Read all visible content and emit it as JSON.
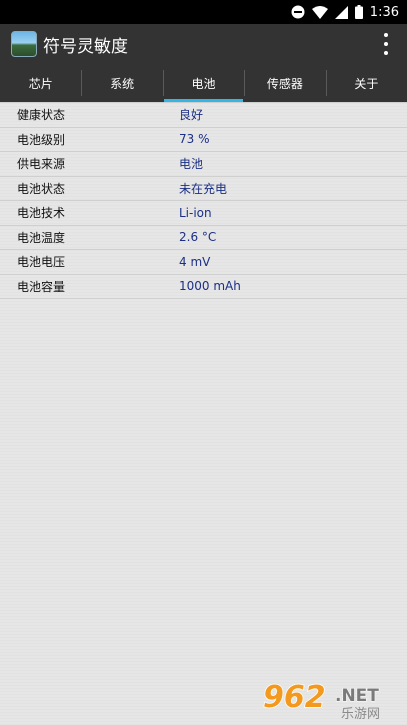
{
  "status_bar": {
    "time": "1:36",
    "icons": [
      "do-not-disturb-icon",
      "wifi-icon",
      "signal-icon",
      "battery-icon"
    ]
  },
  "app_bar": {
    "title": "符号灵敏度",
    "icon": "app-icon",
    "menu_icon": "overflow-menu-icon"
  },
  "tabs": [
    {
      "label": "芯片",
      "active": false
    },
    {
      "label": "系统",
      "active": false
    },
    {
      "label": "电池",
      "active": true
    },
    {
      "label": "传感器",
      "active": false
    },
    {
      "label": "关于",
      "active": false
    }
  ],
  "battery_info": [
    {
      "label": "健康状态",
      "value": "良好"
    },
    {
      "label": "电池级别",
      "value": "73 %"
    },
    {
      "label": "供电来源",
      "value": "电池"
    },
    {
      "label": "电池状态",
      "value": "未在充电"
    },
    {
      "label": "电池技术",
      "value": "Li-ion"
    },
    {
      "label": "电池温度",
      "value": "2.6 °C"
    },
    {
      "label": "电池电压",
      "value": "4 mV"
    },
    {
      "label": "电池容量",
      "value": "1000 mAh"
    }
  ],
  "watermark": {
    "number": "962",
    "suffix": ".NET",
    "sub": "乐游网"
  },
  "colors": {
    "accent": "#33b5e5",
    "value_text": "#1a2f85",
    "bar_background": "#333333",
    "content_background": "#e6e6e6"
  }
}
